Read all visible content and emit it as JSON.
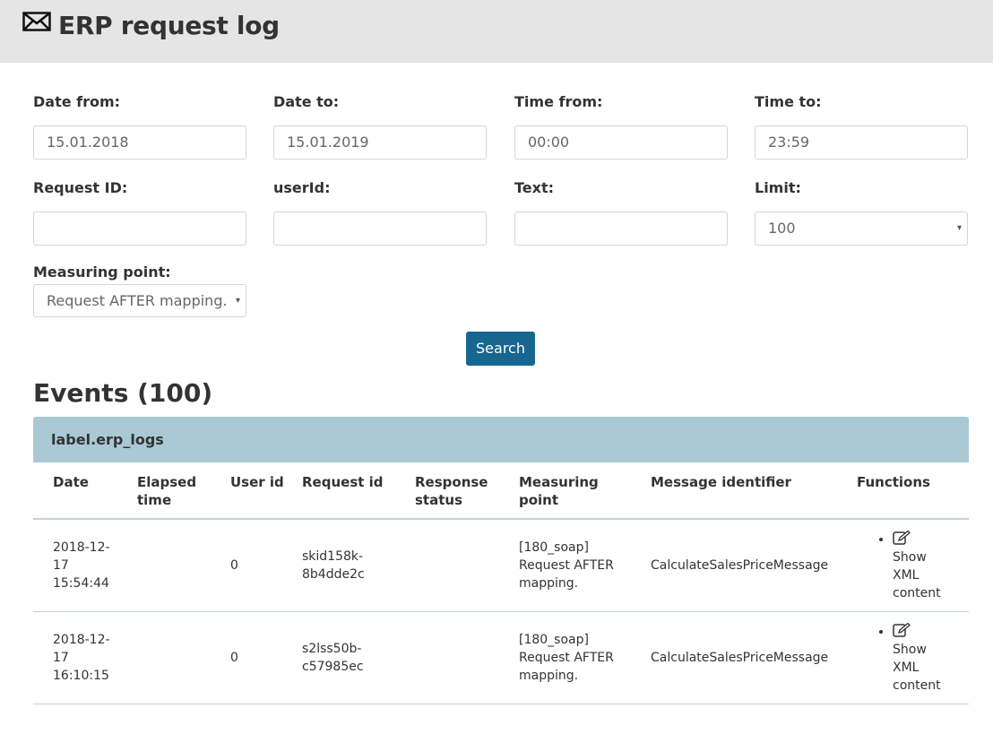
{
  "header": {
    "title": "ERP request log",
    "icon": "envelope-icon"
  },
  "filters": {
    "date_from": {
      "label": "Date from:",
      "value": "15.01.2018"
    },
    "date_to": {
      "label": "Date to:",
      "value": "15.01.2019"
    },
    "time_from": {
      "label": "Time from:",
      "value": "00:00"
    },
    "time_to": {
      "label": "Time to:",
      "value": "23:59"
    },
    "request_id": {
      "label": "Request ID:",
      "value": ""
    },
    "user_id": {
      "label": "userId:",
      "value": ""
    },
    "text": {
      "label": "Text:",
      "value": ""
    },
    "limit": {
      "label": "Limit:",
      "value": "100"
    },
    "measuring_point": {
      "label": "Measuring point:",
      "value": "Request AFTER mapping."
    }
  },
  "search_button": "Search",
  "events": {
    "title": "Events (100)",
    "panel_label": "label.erp_logs",
    "columns": [
      "Date",
      "Elapsed time",
      "User id",
      "Request id",
      "Response status",
      "Measuring point",
      "Message identifier",
      "Functions"
    ],
    "rows": [
      {
        "date": "2018-12-17 15:54:44",
        "elapsed": "",
        "user_id": "0",
        "request_id": "skid158k-8b4dde2c",
        "status": "",
        "measuring_point": "[180_soap] Request AFTER mapping.",
        "message_identifier": "CalculateSalesPriceMessage",
        "function": "Show XML content"
      },
      {
        "date": "2018-12-17 16:10:15",
        "elapsed": "",
        "user_id": "0",
        "request_id": "s2lss50b-c57985ec",
        "status": "",
        "measuring_point": "[180_soap] Request AFTER mapping.",
        "message_identifier": "CalculateSalesPriceMessage",
        "function": "Show XML content"
      }
    ]
  },
  "colors": {
    "header_bg": "#e5e5e5",
    "button": "#16668f",
    "panel_heading": "#a9c9d4"
  }
}
